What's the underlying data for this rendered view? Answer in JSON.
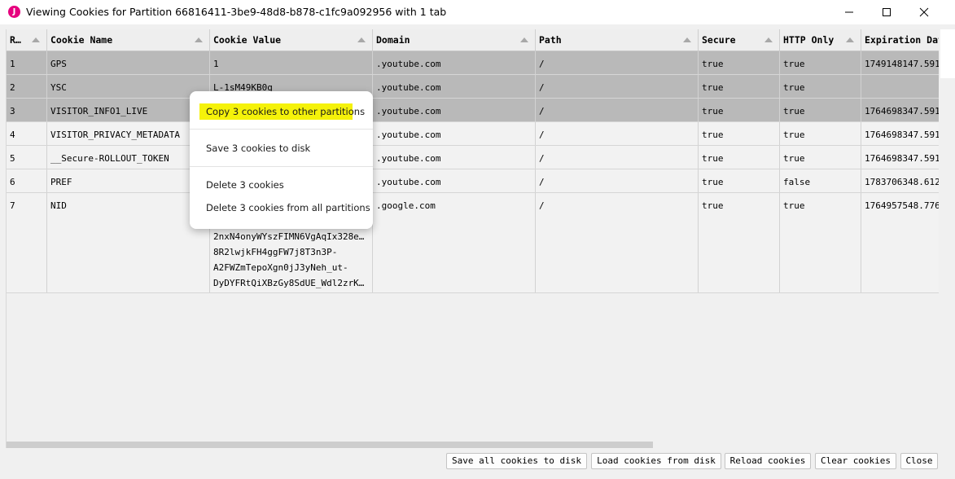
{
  "window": {
    "title": "Viewing Cookies for Partition 66816411-3be9-48d8-b878-c1fc9a092956 with 1 tab",
    "icon_letter": "J",
    "controls": [
      "minimize-icon",
      "maximize-icon",
      "close-icon"
    ]
  },
  "table": {
    "columns": [
      "R…",
      "Cookie Name",
      "Cookie Value",
      "Domain",
      "Path",
      "Secure",
      "HTTP Only",
      "Expiration Dat"
    ],
    "rows": [
      {
        "row": "1",
        "name": "GPS",
        "value": "1",
        "domain": ".youtube.com",
        "path": "/",
        "secure": "true",
        "http_only": "true",
        "expiration": "1749148147.591",
        "selected": true
      },
      {
        "row": "2",
        "name": "YSC",
        "value": "L-1sM49KB0g",
        "domain": ".youtube.com",
        "path": "/",
        "secure": "true",
        "http_only": "true",
        "expiration": "",
        "selected": true
      },
      {
        "row": "3",
        "name": "VISITOR_INFO1_LIVE",
        "value": "",
        "domain": ".youtube.com",
        "path": "/",
        "secure": "true",
        "http_only": "true",
        "expiration": "1764698347.591",
        "selected": true
      },
      {
        "row": "4",
        "name": "VISITOR_PRIVACY_METADATA",
        "value": "",
        "domain": ".youtube.com",
        "path": "/",
        "secure": "true",
        "http_only": "true",
        "expiration": "1764698347.591",
        "selected": false
      },
      {
        "row": "5",
        "name": "__Secure-ROLLOUT_TOKEN",
        "value": "",
        "domain": ".youtube.com",
        "path": "/",
        "secure": "true",
        "http_only": "true",
        "expiration": "1764698347.591",
        "selected": false
      },
      {
        "row": "6",
        "name": "PREF",
        "value": "",
        "domain": ".youtube.com",
        "path": "/",
        "secure": "true",
        "http_only": "false",
        "expiration": "1783706348.612",
        "selected": false
      },
      {
        "row": "7",
        "name": "NID",
        "value": "",
        "value_lines": [
          "2nxN4onyWYszFIMN6VgAqIx328e…",
          "8R2lwjkFH4ggFW7j8T3n3P-",
          "A2FWZmTepoXgn0jJ3yNeh_ut-",
          "DyDYFRtQiXBzGy8SdUE_Wdl2zrK…"
        ],
        "domain": ".google.com",
        "path": "/",
        "secure": "true",
        "http_only": "true",
        "expiration": "1764957548.776",
        "selected": false
      }
    ]
  },
  "context_menu": {
    "copy": "Copy 3 cookies to other partitions",
    "save": "Save 3 cookies to disk",
    "delete": "Delete 3 cookies",
    "delete_all": "Delete 3 cookies from all partitions",
    "highlight_color": "#f5f20a"
  },
  "buttons": {
    "save_all": "Save all cookies to disk",
    "load": "Load cookies from disk",
    "reload": "Reload cookies",
    "clear": "Clear cookies",
    "close": "Close"
  },
  "colors": {
    "selected_row": "#b9b9b9",
    "app_icon": "#e6007e"
  }
}
